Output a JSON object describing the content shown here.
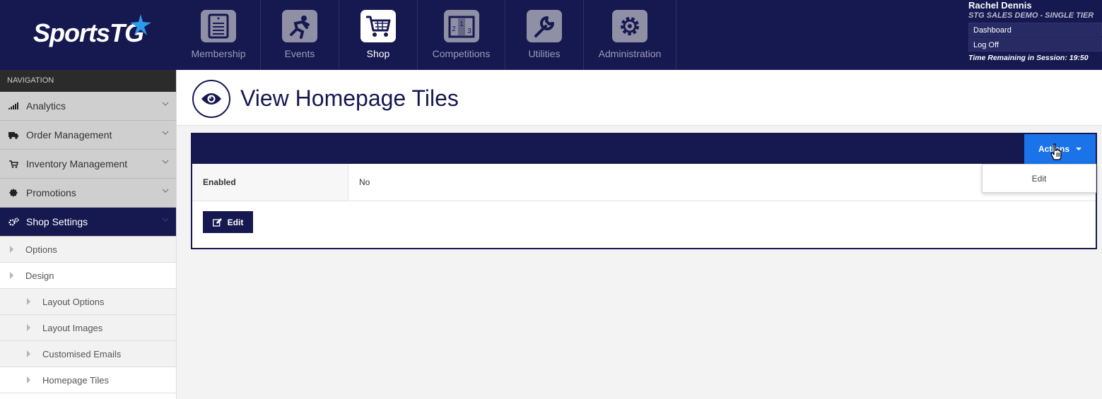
{
  "brand": {
    "logo_text": "SportsTG"
  },
  "modules": [
    {
      "label": "Membership",
      "icon": "membership-icon",
      "active": false
    },
    {
      "label": "Events",
      "icon": "events-icon",
      "active": false
    },
    {
      "label": "Shop",
      "icon": "shop-cart-icon",
      "active": true
    },
    {
      "label": "Competitions",
      "icon": "podium-icon",
      "active": false
    },
    {
      "label": "Utilities",
      "icon": "wrench-icon",
      "active": false
    },
    {
      "label": "Administration",
      "icon": "gear-icon",
      "active": false
    }
  ],
  "user": {
    "name": "Rachel Dennis",
    "org": "STG SALES DEMO - SINGLE TIER",
    "dashboard_link": "Dashboard",
    "logoff_link": "Log Off",
    "session": "Time Remaining in Session: 19:50"
  },
  "sidebar": {
    "heading": "NAVIGATION",
    "items": [
      {
        "label": "Analytics",
        "icon": "bar-chart-icon"
      },
      {
        "label": "Order Management",
        "icon": "truck-icon"
      },
      {
        "label": "Inventory Management",
        "icon": "cart-icon"
      },
      {
        "label": "Promotions",
        "icon": "badge-icon"
      },
      {
        "label": "Shop Settings",
        "icon": "cogs-icon"
      }
    ],
    "sub_items": [
      {
        "label": "Options"
      },
      {
        "label": "Design"
      }
    ],
    "design_items": [
      {
        "label": "Layout Options"
      },
      {
        "label": "Layout Images"
      },
      {
        "label": "Customised Emails"
      },
      {
        "label": "Homepage Tiles"
      }
    ]
  },
  "page": {
    "title": "View Homepage Tiles",
    "title_icon": "eye-icon"
  },
  "panel": {
    "actions_label": "Actions",
    "fields": [
      {
        "label": "Enabled",
        "value": "No"
      }
    ],
    "edit_label": "Edit"
  },
  "dropdown": {
    "items": [
      {
        "label": "Edit"
      }
    ]
  },
  "colors": {
    "navy": "#161850",
    "accent_blue": "#1a73e8",
    "sidebar_gray": "#cfcfcf"
  }
}
